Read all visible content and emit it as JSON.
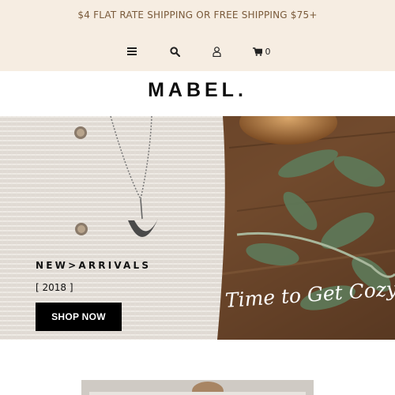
{
  "header": {
    "promo_text": "$4 FLAT RATE SHIPPING OR FREE SHIPPING $75+",
    "icons": [
      "menu-icon",
      "search-icon",
      "account-icon",
      "cart-icon"
    ],
    "cart_count": "0",
    "background": "#f6ede2",
    "promo_color": "#7a5a3a"
  },
  "brand": {
    "logo": "MABEL."
  },
  "hero": {
    "title": "NEW>ARRIVALS",
    "year": "[ 2018 ]",
    "button_label": "SHOP NOW",
    "script_text": "Time to Get Cozy..."
  }
}
